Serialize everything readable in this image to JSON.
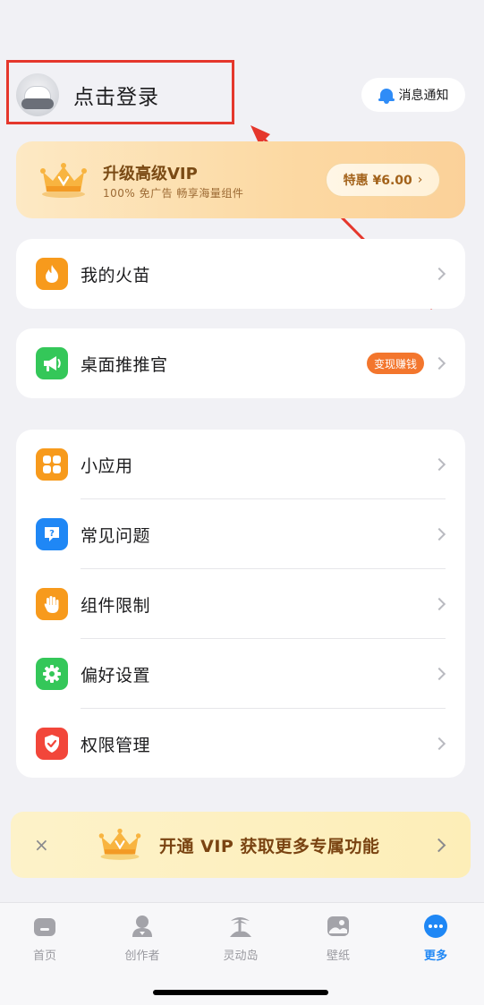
{
  "header": {
    "login_text": "点击登录",
    "notify_label": "消息通知"
  },
  "vip_banner": {
    "title": "升级高级VIP",
    "subtitle": "100% 免广告  畅享海量组件",
    "button_label": "特惠 ¥6.00",
    "chevron": "›"
  },
  "menu": {
    "fire": {
      "label": "我的火苗",
      "icon": "flame-icon"
    },
    "promoter": {
      "label": "桌面推推官",
      "icon": "megaphone-icon",
      "badge": "变现赚钱"
    },
    "group": [
      {
        "label": "小应用",
        "icon": "apps-grid-icon",
        "color": "#f79a1c"
      },
      {
        "label": "常见问题",
        "icon": "question-bubble-icon",
        "color": "#1f87f5"
      },
      {
        "label": "组件限制",
        "icon": "hand-icon",
        "color": "#f79a1c"
      },
      {
        "label": "偏好设置",
        "icon": "gear-icon",
        "color": "#34c759"
      },
      {
        "label": "权限管理",
        "icon": "shield-check-icon",
        "color": "#f2463a"
      }
    ]
  },
  "vip_bar": {
    "close": "×",
    "text": "开通 VIP 获取更多专属功能"
  },
  "tabs": [
    {
      "label": "首页",
      "icon": "home-icon",
      "active": false
    },
    {
      "label": "创作者",
      "icon": "creator-icon",
      "active": false
    },
    {
      "label": "灵动岛",
      "icon": "island-icon",
      "active": false
    },
    {
      "label": "壁纸",
      "icon": "wallpaper-icon",
      "active": false
    },
    {
      "label": "更多",
      "icon": "more-icon",
      "active": true
    }
  ],
  "colors": {
    "accent": "#1f87f5",
    "annotation": "#e5372c",
    "badge": "#f3762d"
  }
}
